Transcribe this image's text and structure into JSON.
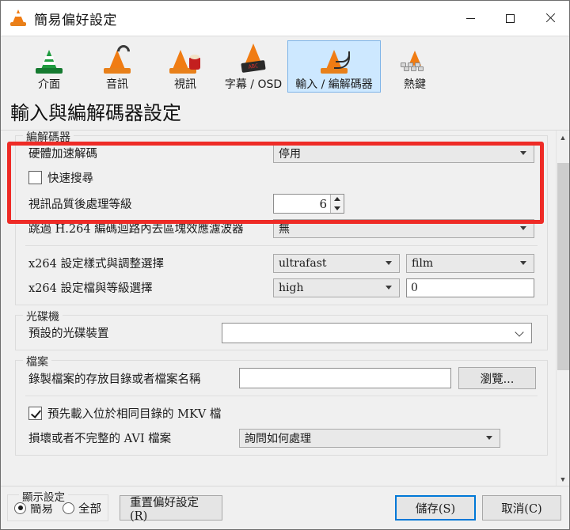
{
  "window": {
    "title": "簡易偏好設定",
    "app_icon": "vlc-cone-icon",
    "controls": {
      "minimize": "minimize-icon",
      "maximize": "maximize-icon",
      "close": "close-icon"
    }
  },
  "toolbar": {
    "items": [
      {
        "label": "介面",
        "icon": "vlc-cone-green-icon",
        "selected": false
      },
      {
        "label": "音訊",
        "icon": "vlc-cone-headphones-icon",
        "selected": false
      },
      {
        "label": "視訊",
        "icon": "vlc-cone-popcorn-icon",
        "selected": false
      },
      {
        "label": "字幕 / OSD",
        "icon": "vlc-cone-subtitle-icon",
        "selected": false
      },
      {
        "label": "輸入 / 編解碼器",
        "icon": "vlc-cone-cables-icon",
        "selected": true
      },
      {
        "label": "熱鍵",
        "icon": "vlc-cone-keyboard-icon",
        "selected": false
      }
    ]
  },
  "page": {
    "heading": "輸入與編解碼器設定"
  },
  "codec_group": {
    "legend": "編解碼器",
    "hw_decode_label": "硬體加速解碼",
    "hw_decode_value": "停用",
    "fast_seek_label": "快速搜尋",
    "fast_seek_checked": false,
    "postproc_label": "視訊品質後處理等級",
    "postproc_value": "6",
    "h264_skip_label": "跳過 H.264 編碼迴路內去區塊效應濾波器",
    "h264_skip_value": "無",
    "x264_preset_label": "x264 設定樣式與調整選擇",
    "x264_preset_value": "ultrafast",
    "x264_tune_value": "film",
    "x264_profile_label": "x264 設定檔與等級選擇",
    "x264_profile_value": "high",
    "x264_level_value": "0"
  },
  "disc_group": {
    "legend": "光碟機",
    "default_device_label": "預設的光碟裝置",
    "default_device_value": ""
  },
  "file_group": {
    "legend": "檔案",
    "record_dir_label": "錄製檔案的存放目錄或者檔案名稱",
    "record_dir_value": "",
    "browse_label": "瀏覽...",
    "mkv_preload_label": "預先載入位於相同目錄的 MKV 檔",
    "mkv_preload_checked": true,
    "avi_label": "損壞或者不完整的 AVI 檔案",
    "avi_value": "詢問如何處理"
  },
  "bottom": {
    "showset_legend": "顯示設定",
    "radio_simple": "簡易",
    "radio_all": "全部",
    "radio_selected": "簡易",
    "reset_label": "重置偏好設定(R)",
    "save_label": "儲存(S)",
    "cancel_label": "取消(C)"
  },
  "scrollbar": {
    "up_icon": "chevron-up-icon",
    "down_icon": "chevron-down-icon"
  },
  "annotation": {
    "highlight_color": "#ee2b26"
  }
}
